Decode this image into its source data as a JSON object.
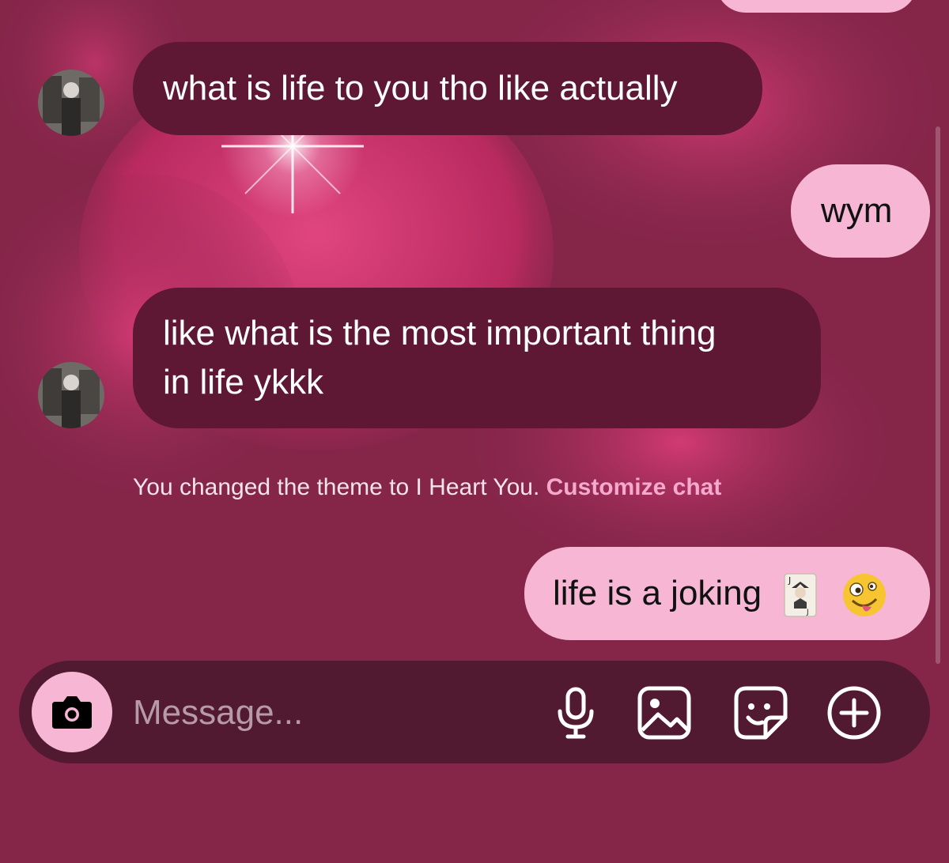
{
  "messages": [
    {
      "id": "m1",
      "direction": "incoming",
      "text": "what is life to you tho like actually"
    },
    {
      "id": "m2",
      "direction": "outgoing",
      "text": "wym"
    },
    {
      "id": "m3",
      "direction": "incoming",
      "line1": "like what is the most important thing",
      "line2": "in life ykkk"
    },
    {
      "id": "m5",
      "direction": "outgoing",
      "text": "life is a joking",
      "emojis": [
        "joker-card-icon",
        "zany-face-icon"
      ]
    }
  ],
  "system_note": {
    "text": "You changed the theme to I Heart You.",
    "link": "Customize chat"
  },
  "composer": {
    "placeholder": "Message...",
    "icons": [
      "camera-icon",
      "microphone-icon",
      "image-icon",
      "sticker-icon",
      "plus-circle-icon"
    ]
  },
  "theme": {
    "background": "#852649",
    "incoming_bubble": "#5e1834",
    "outgoing_bubble": "#f6b6d4",
    "composer": "#521a31",
    "link": "#f5a9cc"
  }
}
